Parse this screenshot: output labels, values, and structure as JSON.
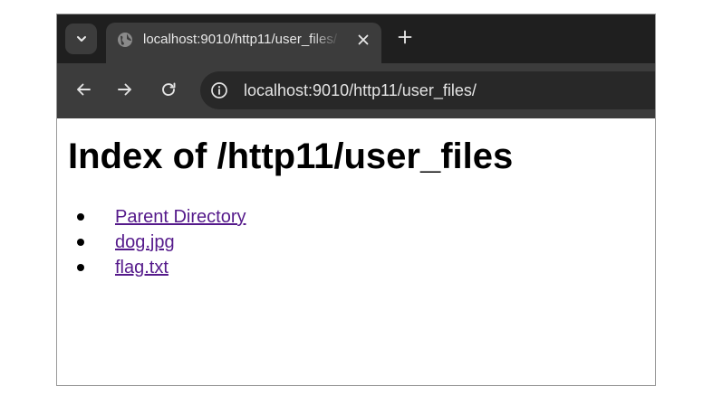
{
  "browser": {
    "tab": {
      "title": "localhost:9010/http11/user_files/",
      "favicon": "globe-icon"
    },
    "toolbar": {
      "url": "localhost:9010/http11/user_files/"
    },
    "icons": {
      "tab_search": "chevron-down-icon",
      "close": "close-icon",
      "new_tab": "plus-icon",
      "back": "back-arrow-icon",
      "forward": "forward-arrow-icon",
      "reload": "reload-icon",
      "site_info": "info-icon"
    },
    "colors": {
      "tabstrip": "#1f1f1f",
      "toolbar": "#3c3c3c",
      "omnibox": "#282828",
      "link_visited": "#551a8b"
    }
  },
  "page": {
    "heading": "Index of /http11/user_files",
    "items": [
      {
        "label": "Parent Directory"
      },
      {
        "label": "dog.jpg"
      },
      {
        "label": "flag.txt"
      }
    ]
  }
}
